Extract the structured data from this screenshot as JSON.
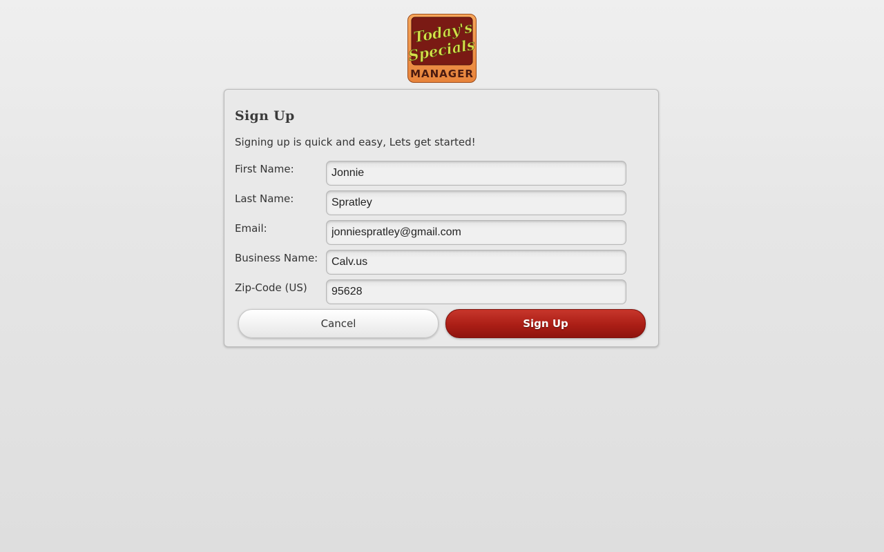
{
  "logo": {
    "line1": "Today's",
    "line2": "Specials",
    "line3": "MANAGER"
  },
  "signup_form": {
    "title": "Sign Up",
    "subtitle": "Signing up is quick and easy, Lets get started!",
    "fields": [
      {
        "label": "First Name:",
        "value": "Jonnie"
      },
      {
        "label": "Last Name:",
        "value": "Spratley"
      },
      {
        "label": "Email:",
        "value": "jonniespratley@gmail.com"
      },
      {
        "label": "Business Name:",
        "value": "Calv.us"
      },
      {
        "label": "Zip-Code (US)",
        "value": "95628"
      }
    ],
    "cancel_label": "Cancel",
    "submit_label": "Sign Up"
  },
  "colors": {
    "accent_red": "#ab1e16",
    "logo_orange": "#f0954a",
    "logo_maroon": "#7a1a14",
    "logo_yellow_green": "#d6e04a"
  }
}
